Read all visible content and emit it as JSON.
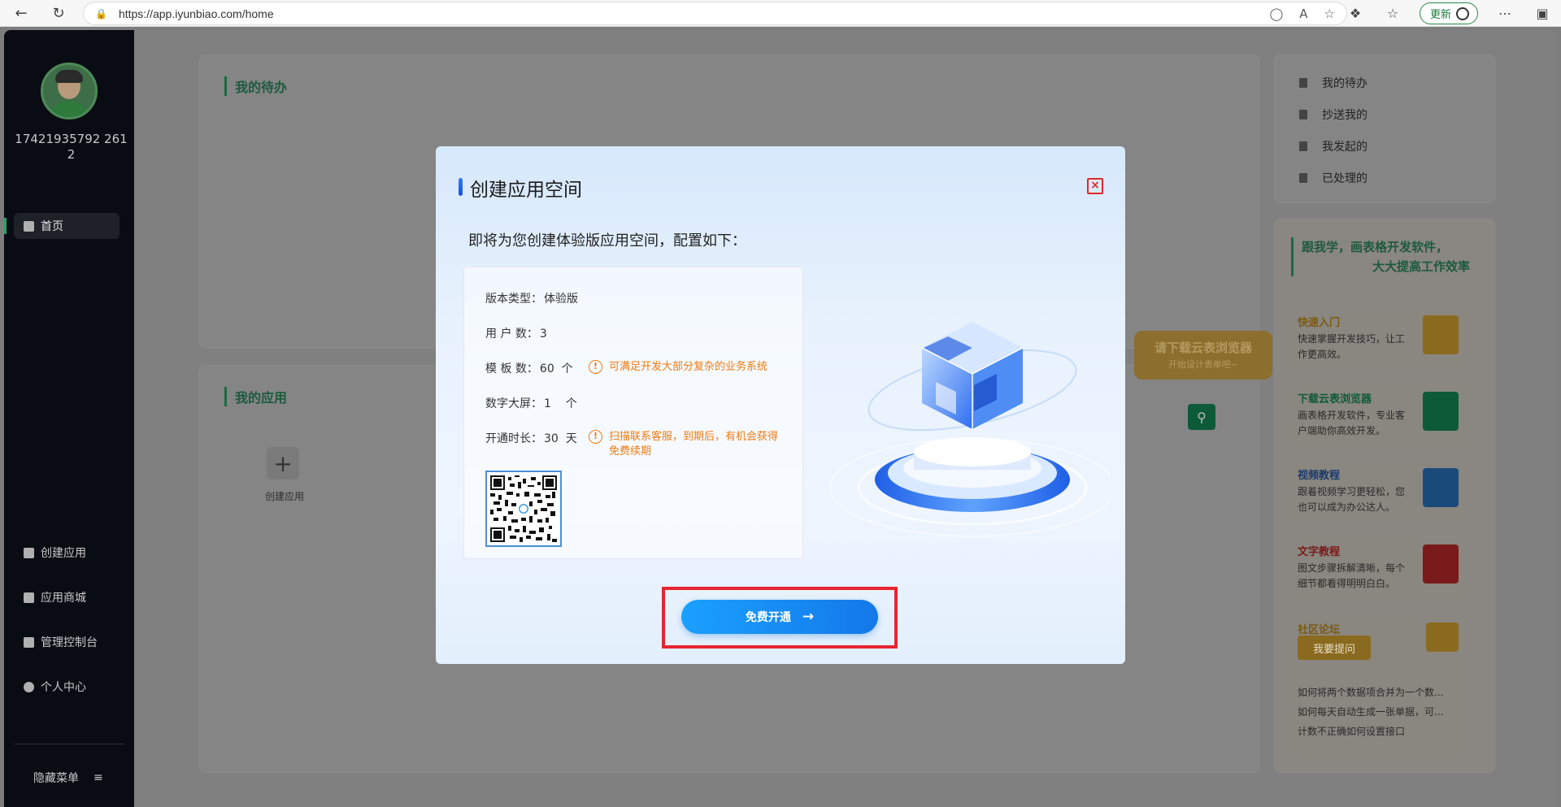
{
  "browser": {
    "url": "https://app.iyunbiao.com/home",
    "update_label": "更新"
  },
  "sidebar": {
    "username": "17421935792 2612",
    "items": [
      {
        "label": "首页",
        "active": true
      },
      {
        "label": "创建应用"
      },
      {
        "label": "应用商城"
      },
      {
        "label": "管理控制台"
      },
      {
        "label": "个人中心"
      }
    ],
    "hide_menu": "隐藏菜单"
  },
  "main": {
    "todo_title": "我的待办",
    "apps_title": "我的应用",
    "create_app_label": "创建应用"
  },
  "right_panel": {
    "links": [
      "我的待办",
      "抄送我的",
      "我发起的",
      "已处理的"
    ],
    "learn_title_1": "跟我学，画表格开发软件，",
    "learn_title_2": "大大提高工作效率",
    "cards": [
      {
        "title": "快速入门",
        "desc": "快速掌握开发技巧，让工作更高效。",
        "color": "#8a6a1e"
      },
      {
        "title": "下载云表浏览器",
        "desc": "画表格开发软件，专业客户端助你高效开发。",
        "color": "#0d5a38"
      },
      {
        "title": "视频教程",
        "desc": "跟着视频学习更轻松，您也可以成为办公达人。",
        "color": "#1a3a6a"
      },
      {
        "title": "文字教程",
        "desc": "图文步骤拆解清晰，每个细节都看得明明白白。",
        "color": "#7a1a1a"
      }
    ],
    "forum": {
      "title": "社区论坛",
      "ask_label": "我要提问",
      "posts": [
        "如何将两个数据项合并为一个数...",
        "如何每天自动生成一张单据，可...",
        "计数不正确如何设置接口"
      ]
    },
    "promo": {
      "title": "请下载云表浏览器",
      "subtitle": "开始设计表单吧~"
    }
  },
  "modal": {
    "title": "创建应用空间",
    "subtitle": "即将为您创建体验版应用空间，配置如下：",
    "rows": [
      {
        "label": "版本类型：",
        "value": "体验版"
      },
      {
        "label": "用 户 数：",
        "value": "3"
      },
      {
        "label": "模 板 数：",
        "value": "60  个"
      },
      {
        "label": "数字大屏：",
        "value": "1    个"
      },
      {
        "label": "开通时长：",
        "value": "30  天"
      }
    ],
    "warn_templates": "可满足开发大部分复杂的业务系统",
    "warn_duration": "扫描联系客服，到期后，有机会获得免费续期",
    "cta_label": "免费开通",
    "close_symbol": "×",
    "accent_color": "#1478e8",
    "highlight_color": "#e52531"
  }
}
